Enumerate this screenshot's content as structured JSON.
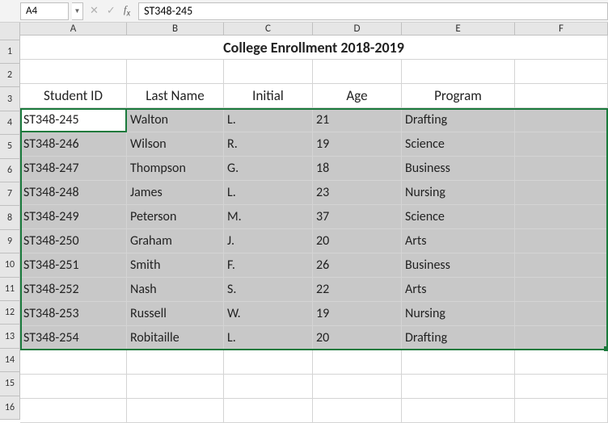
{
  "formula_bar": {
    "name_box": "A4",
    "formula": "ST348-245"
  },
  "columns": [
    "A",
    "B",
    "C",
    "D",
    "E",
    "F"
  ],
  "row_numbers": [
    1,
    2,
    3,
    4,
    5,
    6,
    7,
    8,
    9,
    10,
    11,
    12,
    13,
    14,
    15,
    16
  ],
  "title": "College Enrollment 2018-2019",
  "headers": {
    "student_id": "Student ID",
    "last_name": "Last Name",
    "initial": "Initial",
    "age": "Age",
    "program": "Program"
  },
  "data": [
    {
      "id": "ST348-245",
      "last": "Walton",
      "init": "L.",
      "age": "21",
      "prog": "Drafting"
    },
    {
      "id": "ST348-246",
      "last": "Wilson",
      "init": "R.",
      "age": "19",
      "prog": "Science"
    },
    {
      "id": "ST348-247",
      "last": "Thompson",
      "init": "G.",
      "age": "18",
      "prog": "Business"
    },
    {
      "id": "ST348-248",
      "last": "James",
      "init": "L.",
      "age": "23",
      "prog": "Nursing"
    },
    {
      "id": "ST348-249",
      "last": "Peterson",
      "init": "M.",
      "age": "37",
      "prog": "Science"
    },
    {
      "id": "ST348-250",
      "last": "Graham",
      "init": "J.",
      "age": "20",
      "prog": "Arts"
    },
    {
      "id": "ST348-251",
      "last": "Smith",
      "init": "F.",
      "age": "26",
      "prog": "Business"
    },
    {
      "id": "ST348-252",
      "last": "Nash",
      "init": "S.",
      "age": "22",
      "prog": "Arts"
    },
    {
      "id": "ST348-253",
      "last": "Russell",
      "init": "W.",
      "age": "19",
      "prog": "Nursing"
    },
    {
      "id": "ST348-254",
      "last": "Robitaille",
      "init": "L.",
      "age": "20",
      "prog": "Drafting"
    }
  ],
  "active_cell": "A4",
  "selection_range": "A4:F13"
}
